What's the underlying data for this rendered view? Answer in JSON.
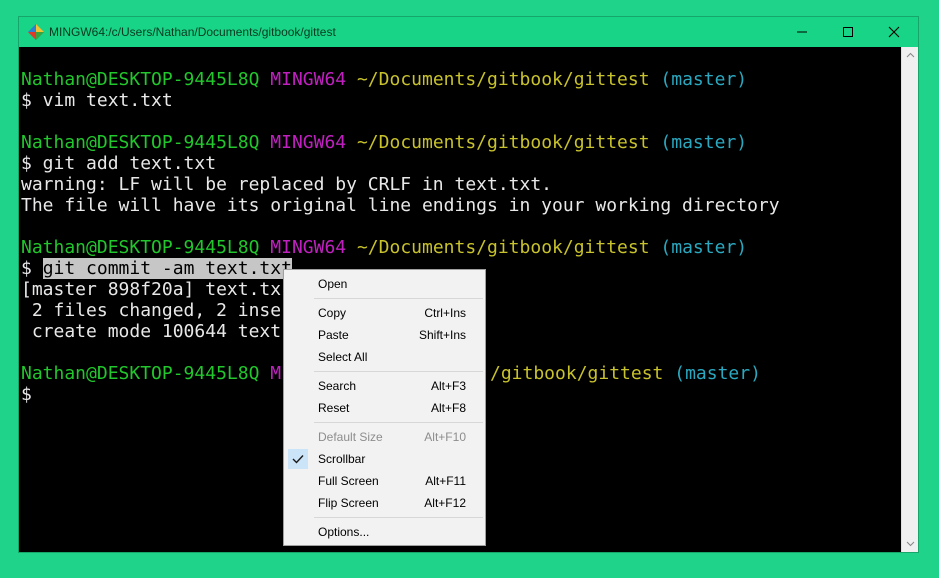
{
  "window": {
    "title": "MINGW64:/c/Users/Nathan/Documents/gitbook/gittest"
  },
  "terminal": {
    "prompt_user": "Nathan@DESKTOP-9445L8Q",
    "prompt_shell": "MINGW64",
    "prompt_path": "~/Documents/gitbook/gittest",
    "prompt_branch": "(master)",
    "dollar": "$",
    "cmd1": " vim text.txt",
    "cmd2": " git add text.txt",
    "out2a": "warning: LF will be replaced by CRLF in text.txt.",
    "out2b": "The file will have its original line endings in your working directory",
    "cmd3_selected": "git commit -am text.txt",
    "out3a": "[master 898f20a] text.tx",
    "out3b": " 2 files changed, 2 inse",
    "out3c": " create mode 100644 text",
    "prompt4_user": "Nathan@DESKTOP-9445L8Q",
    "prompt4_shell": "M",
    "prompt4_path": "/gitbook/gittest",
    "prompt4_branch": "(master)"
  },
  "context_menu": {
    "items": [
      {
        "label": "Open",
        "shortcut": ""
      },
      {
        "label": "Copy",
        "shortcut": "Ctrl+Ins"
      },
      {
        "label": "Paste",
        "shortcut": "Shift+Ins"
      },
      {
        "label": "Select All",
        "shortcut": ""
      },
      {
        "label": "Search",
        "shortcut": "Alt+F3"
      },
      {
        "label": "Reset",
        "shortcut": "Alt+F8"
      },
      {
        "label": "Default Size",
        "shortcut": "Alt+F10",
        "disabled": true
      },
      {
        "label": "Scrollbar",
        "shortcut": "",
        "checked": true
      },
      {
        "label": "Full Screen",
        "shortcut": "Alt+F11"
      },
      {
        "label": "Flip Screen",
        "shortcut": "Alt+F12"
      },
      {
        "label": "Options...",
        "shortcut": ""
      }
    ]
  },
  "colors": {
    "desktop": "#1fd38a",
    "titlebar": "#18d486",
    "prompt_green": "#21c72c",
    "prompt_magenta": "#c120c1",
    "prompt_yellow": "#c8c22c",
    "prompt_cyan": "#2aa8c0"
  },
  "icons": {
    "app": "mingw-diamond-icon",
    "minimize": "minimize-icon",
    "maximize": "maximize-icon",
    "close": "close-icon",
    "check": "checkmark-icon"
  }
}
